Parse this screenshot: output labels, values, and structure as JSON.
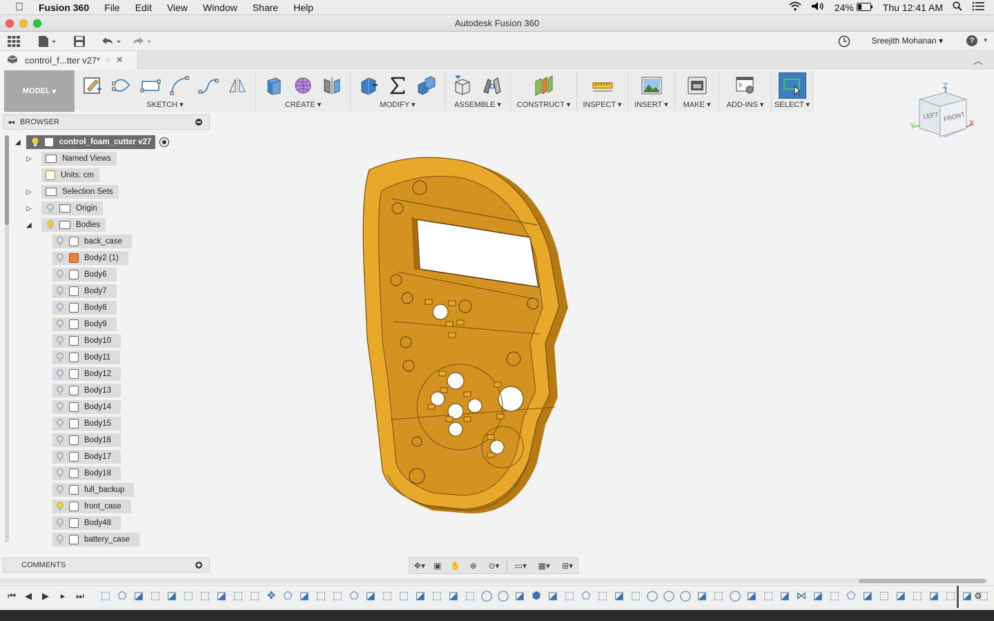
{
  "menubar": {
    "app_name": "Fusion 360",
    "items": [
      "File",
      "Edit",
      "View",
      "Window",
      "Share",
      "Help"
    ],
    "battery": "24%",
    "clock": "Thu 12:41 AM"
  },
  "window": {
    "title": "Autodesk Fusion 360"
  },
  "appbar": {
    "user": "Sreejith Mohanan"
  },
  "document_tab": {
    "label": "control_f...tter v27*"
  },
  "toolbar": {
    "workspace": "MODEL",
    "groups": [
      "SKETCH",
      "CREATE",
      "MODIFY",
      "ASSEMBLE",
      "CONSTRUCT",
      "INSPECT",
      "INSERT",
      "MAKE",
      "ADD-INS",
      "SELECT"
    ]
  },
  "browser": {
    "title": "BROWSER",
    "root": "control_foam_cutter v27",
    "nodes": [
      "Named Views",
      "Units: cm",
      "Selection Sets",
      "Origin",
      "Bodies"
    ],
    "bodies": [
      "back_case",
      "Body2 (1)",
      "Body6",
      "Body7",
      "Body8",
      "Body9",
      "Body10",
      "Body11",
      "Body12",
      "Body13",
      "Body14",
      "Body15",
      "Body16",
      "Body17",
      "Body18",
      "full_backup",
      "front_case",
      "Body48",
      "battery_case"
    ]
  },
  "comments": {
    "title": "COMMENTS"
  },
  "viewcube": {
    "top": "Z",
    "left_face": "LEFT",
    "front_face": "FRONT",
    "x": "X",
    "y": "Y"
  },
  "colors": {
    "model": "#e8a82a",
    "model_dark": "#b57a12",
    "select_active": "#3a7fc1",
    "model_btn": "#a8a8a8"
  }
}
